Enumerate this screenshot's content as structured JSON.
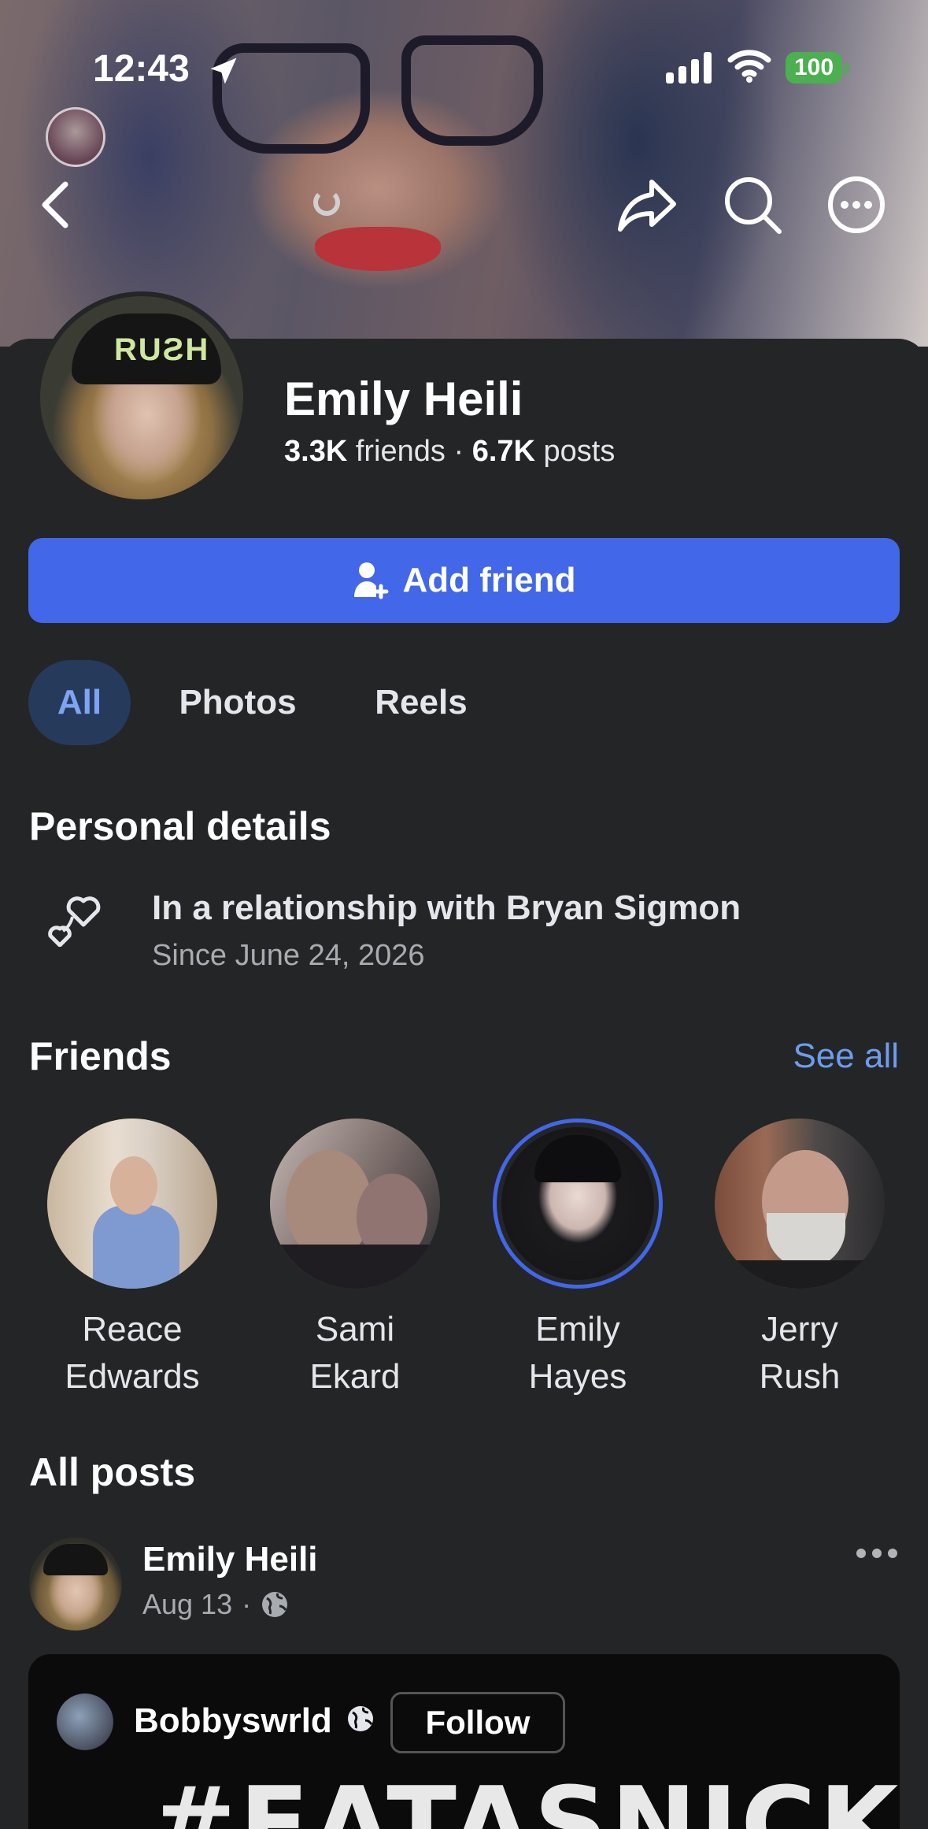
{
  "status_bar": {
    "time": "12:43",
    "battery": "100"
  },
  "profile": {
    "name": "Emily Heili",
    "friends_count": "3.3K",
    "friends_label": "friends",
    "separator": "·",
    "posts_count": "6.7K",
    "posts_label": "posts"
  },
  "actions": {
    "add_friend": "Add friend"
  },
  "tabs": [
    {
      "label": "All",
      "active": true
    },
    {
      "label": "Photos",
      "active": false
    },
    {
      "label": "Reels",
      "active": false
    }
  ],
  "personal_details": {
    "title": "Personal details",
    "relationship": "In a relationship with Bryan Sigmon",
    "since": "Since June 24, 2026"
  },
  "friends": {
    "title": "Friends",
    "see_all": "See all",
    "items": [
      {
        "first": "Reace",
        "last": "Edwards"
      },
      {
        "first": "Sami",
        "last": "Ekard"
      },
      {
        "first": "Emily",
        "last": "Hayes"
      },
      {
        "first": "Jerry",
        "last": "Rush"
      }
    ]
  },
  "posts": {
    "title": "All posts",
    "first": {
      "author": "Emily Heili",
      "date": "Aug 13",
      "dot": "·",
      "shared": {
        "author": "Bobbyswrld",
        "follow": "Follow",
        "text": "#EATASNICKERS"
      }
    }
  },
  "colors": {
    "accent": "#4267e8",
    "link": "#6d9cf0",
    "background": "#242526",
    "battery": "#4caf50"
  }
}
